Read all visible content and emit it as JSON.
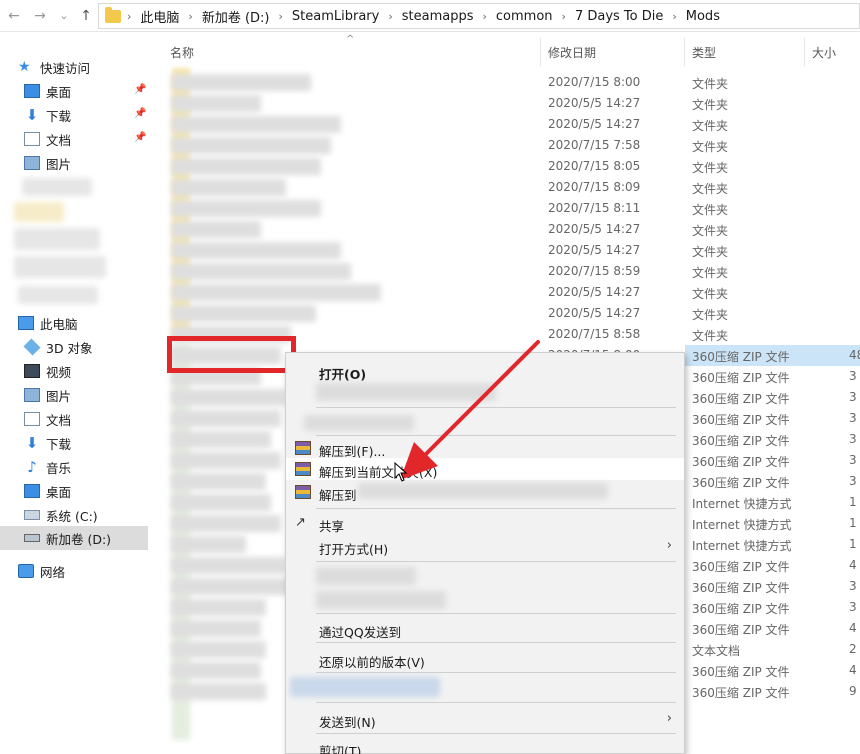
{
  "nav": {
    "back": "←",
    "forward": "→",
    "recent": "⌄",
    "up": "↑"
  },
  "breadcrumb": [
    "此电脑",
    "新加卷 (D:)",
    "SteamLibrary",
    "steamapps",
    "common",
    "7 Days To Die",
    "Mods"
  ],
  "sidebar": {
    "quick_access": "快速访问",
    "quick_items": [
      "桌面",
      "下载",
      "文档",
      "图片"
    ],
    "this_pc": "此电脑",
    "pc_items": [
      "3D 对象",
      "视频",
      "图片",
      "文档",
      "下载",
      "音乐",
      "桌面",
      "系统 (C:)",
      "新加卷 (D:)"
    ],
    "network": "网络"
  },
  "columns": {
    "name": "名称",
    "date": "修改日期",
    "type": "类型",
    "size": "大小"
  },
  "rows": [
    {
      "date": "2020/7/15 8:00",
      "type": "文件夹",
      "size": ""
    },
    {
      "date": "2020/5/5 14:27",
      "type": "文件夹",
      "size": ""
    },
    {
      "date": "2020/5/5 14:27",
      "type": "文件夹",
      "size": ""
    },
    {
      "date": "2020/7/15 7:58",
      "type": "文件夹",
      "size": ""
    },
    {
      "date": "2020/7/15 8:05",
      "type": "文件夹",
      "size": ""
    },
    {
      "date": "2020/7/15 8:09",
      "type": "文件夹",
      "size": ""
    },
    {
      "date": "2020/7/15 8:11",
      "type": "文件夹",
      "size": ""
    },
    {
      "date": "2020/5/5 14:27",
      "type": "文件夹",
      "size": ""
    },
    {
      "date": "2020/5/5 14:27",
      "type": "文件夹",
      "size": ""
    },
    {
      "date": "2020/7/15 8:59",
      "type": "文件夹",
      "size": ""
    },
    {
      "date": "2020/5/5 14:27",
      "type": "文件夹",
      "size": ""
    },
    {
      "date": "2020/5/5 14:27",
      "type": "文件夹",
      "size": ""
    },
    {
      "date": "2020/7/15 8:58",
      "type": "文件夹",
      "size": ""
    },
    {
      "date": "2020/7/15 8:00",
      "type": "360压缩 ZIP 文件",
      "size": "48"
    },
    {
      "date": "",
      "type": "360压缩 ZIP 文件",
      "size": "3"
    },
    {
      "date": "",
      "type": "360压缩 ZIP 文件",
      "size": "3"
    },
    {
      "date": "",
      "type": "360压缩 ZIP 文件",
      "size": "3"
    },
    {
      "date": "",
      "type": "360压缩 ZIP 文件",
      "size": "3"
    },
    {
      "date": "",
      "type": "360压缩 ZIP 文件",
      "size": "3"
    },
    {
      "date": "",
      "type": "360压缩 ZIP 文件",
      "size": "3"
    },
    {
      "date": "",
      "type": "Internet 快捷方式",
      "size": "1"
    },
    {
      "date": "",
      "type": "Internet 快捷方式",
      "size": "1"
    },
    {
      "date": "",
      "type": "Internet 快捷方式",
      "size": "1"
    },
    {
      "date": "",
      "type": "360压缩 ZIP 文件",
      "size": "4"
    },
    {
      "date": "",
      "type": "360压缩 ZIP 文件",
      "size": "3"
    },
    {
      "date": "",
      "type": "360压缩 ZIP 文件",
      "size": "3"
    },
    {
      "date": "",
      "type": "360压缩 ZIP 文件",
      "size": "4"
    },
    {
      "date": "",
      "type": "文本文档",
      "size": "2"
    },
    {
      "date": "",
      "type": "360压缩 ZIP 文件",
      "size": "4"
    },
    {
      "date": "",
      "type": "360压缩 ZIP 文件",
      "size": "9"
    }
  ],
  "context_menu": {
    "open": "打开(O)",
    "extract_to": "解压到(F)...",
    "extract_here": "解压到当前文件夹(X)",
    "extract_to_named": "解压到",
    "share": "共享",
    "open_with": "打开方式(H)",
    "send_qq": "通过QQ发送到",
    "restore": "还原以前的版本(V)",
    "send_to": "发送到(N)",
    "cut": "剪切(T)",
    "submenu_arrow": "›"
  },
  "colors": {
    "accent_red": "#e2272b",
    "selection_blue": "#cce4f7",
    "folder_yellow": "#f3c94b"
  }
}
